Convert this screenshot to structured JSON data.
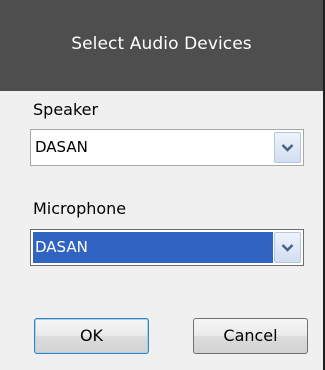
{
  "dialog": {
    "title": "Select Audio Devices"
  },
  "speaker": {
    "label": "Speaker",
    "selected": "DASAN"
  },
  "microphone": {
    "label": "Microphone",
    "selected": "DASAN"
  },
  "buttons": {
    "ok_label": "OK",
    "cancel_label": "Cancel"
  },
  "icons": {
    "dropdown": "chevron-down-icon"
  },
  "colors": {
    "header_bg": "#4e4e4e",
    "dialog_bg": "#f0f0f0",
    "selection_bg": "#3163c2"
  }
}
